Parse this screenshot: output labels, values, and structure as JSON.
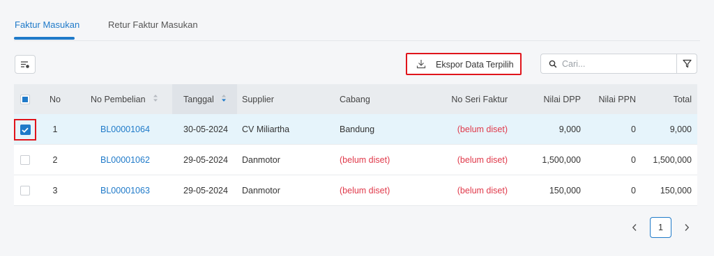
{
  "tabs": [
    {
      "label": "Faktur Masukan",
      "active": true
    },
    {
      "label": "Retur Faktur Masukan",
      "active": false
    }
  ],
  "toolbar": {
    "columns_icon": "column-settings-icon",
    "export_label": "Ekspor Data Terpilih",
    "export_icon": "download-icon",
    "search_placeholder": "Cari...",
    "search_value": "",
    "filter_icon": "filter-icon"
  },
  "table": {
    "columns": [
      "No",
      "No Pembelian",
      "Tanggal",
      "Supplier",
      "Cabang",
      "No Seri Faktur",
      "Nilai DPP",
      "Nilai PPN",
      "Total"
    ],
    "rows": [
      {
        "checked": true,
        "no": "1",
        "no_pembelian": "BL00001064",
        "tanggal": "30-05-2024",
        "supplier": "CV Miliartha",
        "cabang": "Bandung",
        "no_seri_faktur": "(belum diset)",
        "nilai_dpp": "9,000",
        "nilai_ppn": "0",
        "total": "9,000"
      },
      {
        "checked": false,
        "no": "2",
        "no_pembelian": "BL00001062",
        "tanggal": "29-05-2024",
        "supplier": "Danmotor",
        "cabang": "(belum diset)",
        "no_seri_faktur": "(belum diset)",
        "nilai_dpp": "1,500,000",
        "nilai_ppn": "0",
        "total": "1,500,000"
      },
      {
        "checked": false,
        "no": "3",
        "no_pembelian": "BL00001063",
        "tanggal": "29-05-2024",
        "supplier": "Danmotor",
        "cabang": "(belum diset)",
        "no_seri_faktur": "(belum diset)",
        "nilai_dpp": "150,000",
        "nilai_ppn": "0",
        "total": "150,000"
      }
    ]
  },
  "pagination": {
    "current_page": "1"
  },
  "colors": {
    "accent": "#1f7ac9",
    "unset_text": "#e0394a",
    "highlight": "#e0141b",
    "selected_row": "#e6f4fb"
  }
}
